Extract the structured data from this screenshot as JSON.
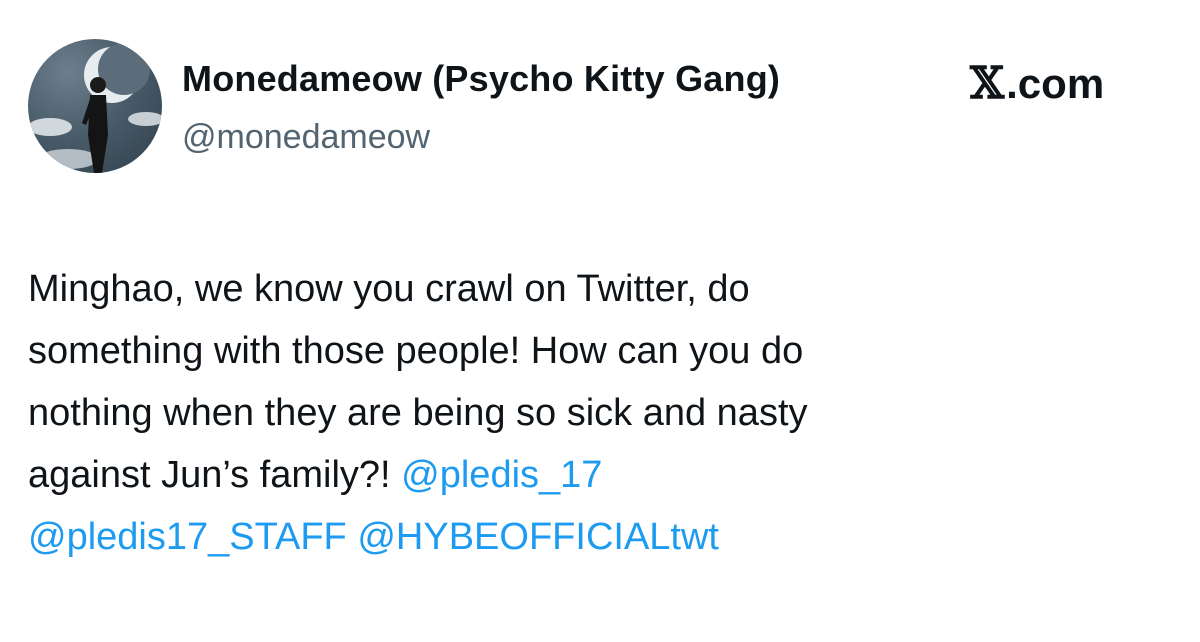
{
  "author": {
    "display_name": "Monedameow (Psycho Kitty Gang)",
    "handle": "@monedameow",
    "avatar": "profile-photo"
  },
  "brand": {
    "glyph": "𝕏",
    "label": ".com"
  },
  "tweet": {
    "lines": [
      "Minghao, we know you crawl on Twitter, do",
      "something with those people! How can you do",
      "nothing when they are being so sick and nasty",
      "against Jun’s family?! "
    ],
    "mentions": [
      "@pledis_17",
      "@pledis17_STAFF",
      "@HYBEOFFICIALtwt"
    ]
  },
  "colors": {
    "text": "#0f1419",
    "secondary": "#536471",
    "link": "#1d9bf0",
    "background": "#ffffff"
  }
}
